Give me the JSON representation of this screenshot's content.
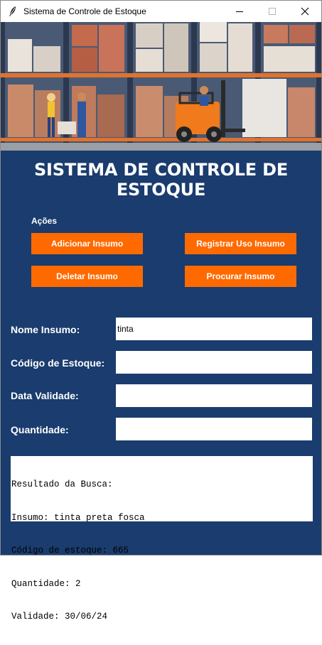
{
  "window": {
    "title": "Sistema de Controle de Estoque"
  },
  "header": {
    "title": "SISTEMA DE CONTROLE DE ESTOQUE"
  },
  "actions": {
    "label": "Ações",
    "add_label": "Adicionar Insumo",
    "register_label": "Registrar Uso Insumo",
    "delete_label": "Deletar Insumo",
    "search_label": "Procurar Insumo"
  },
  "form": {
    "name_label": "Nome Insumo:",
    "name_value": "tinta",
    "code_label": "Código de Estoque:",
    "code_value": "",
    "expiry_label": "Data Validade:",
    "expiry_value": "",
    "quantity_label": "Quantidade:",
    "quantity_value": ""
  },
  "result": {
    "lines": [
      "Resultado da Busca:",
      "Insumo: tinta preta fosca",
      "Código de estoque: 665",
      "Quantidade: 2",
      "Validade: 30/06/24"
    ]
  },
  "colors": {
    "background": "#1a3c6e",
    "accent": "#ff6a00"
  }
}
